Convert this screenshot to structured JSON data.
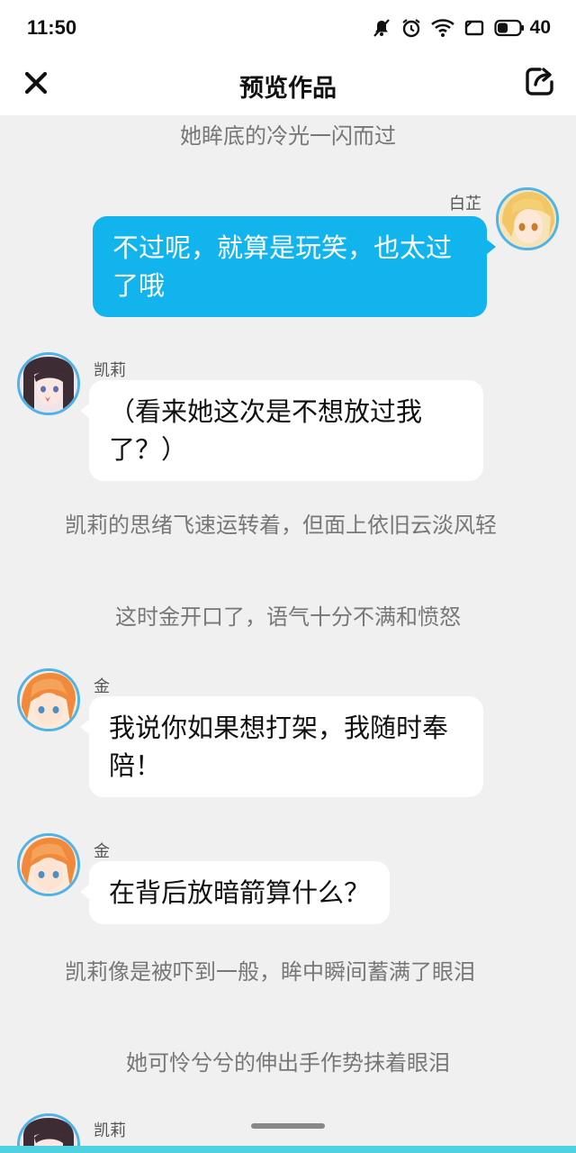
{
  "status_bar": {
    "time": "11:50",
    "battery": "40",
    "icons": [
      "mute-icon",
      "alarm-icon",
      "wifi-icon",
      "screen-icon",
      "battery-icon"
    ]
  },
  "nav": {
    "title": "预览作品",
    "close_icon": "close-icon",
    "share_icon": "share-icon"
  },
  "story": {
    "narration_1": "她眸底的冷光一闪而过",
    "msg_1": {
      "speaker": "白芷",
      "text": "不过呢，就算是玩笑，也太过了哦"
    },
    "msg_2": {
      "speaker": "凯莉",
      "text": "（看来她这次是不想放过我了？）"
    },
    "narration_2": "凯莉的思绪飞速运转着，但面上依旧云淡风轻",
    "narration_3": "这时金开口了，语气十分不满和愤怒",
    "msg_3": {
      "speaker": "金",
      "text": "我说你如果想打架，我随时奉陪！"
    },
    "msg_4": {
      "speaker": "金",
      "text": "在背后放暗箭算什么？"
    },
    "narration_4": "凯莉像是被吓到一般，眸中瞬间蓄满了眼泪",
    "narration_5": "她可怜兮兮的伸出手作势抹着眼泪",
    "msg_5": {
      "speaker": "凯莉"
    }
  },
  "colors": {
    "accent": "#12b4ee",
    "avatar_border": "#4fb3e8",
    "background": "#f0f0f0",
    "narration_text": "#777777"
  }
}
